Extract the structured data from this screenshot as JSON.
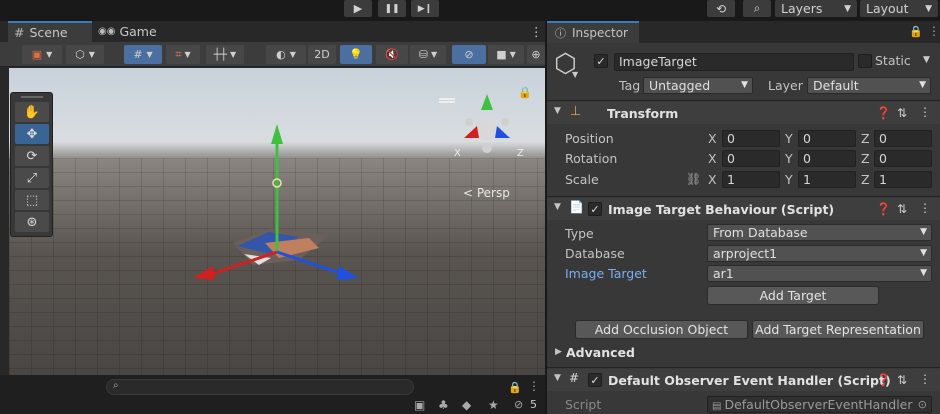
{
  "toolbar": {
    "play_icon": "▶",
    "pause_icon": "❚❚",
    "step_icon": "▶❙",
    "history_icon": "⟲",
    "search_icon": "⌕",
    "layers_label": "Layers",
    "layout_label": "Layout"
  },
  "scene": {
    "tabs": [
      {
        "label": "Scene",
        "icon": "#"
      },
      {
        "label": "Game",
        "icon": "👓"
      }
    ],
    "tool_2d_label": "2D",
    "persp_label": "< Persp",
    "axis_x": "X",
    "axis_z": "Z",
    "bottom_count": "5"
  },
  "inspector": {
    "tab_label": "Inspector",
    "object_name": "ImageTarget",
    "static_label": "Static",
    "tag_label": "Tag",
    "tag_value": "Untagged",
    "layer_label": "Layer",
    "layer_value": "Default",
    "transform": {
      "title": "Transform",
      "rows": [
        {
          "label": "Position",
          "x": "0",
          "y": "0",
          "z": "0"
        },
        {
          "label": "Rotation",
          "x": "0",
          "y": "0",
          "z": "0"
        },
        {
          "label": "Scale",
          "x": "1",
          "y": "1",
          "z": "1"
        }
      ]
    },
    "itb": {
      "title": "Image Target Behaviour (Script)",
      "type_label": "Type",
      "type_value": "From Database",
      "database_label": "Database",
      "database_value": "arproject1",
      "image_target_label": "Image Target",
      "image_target_value": "ar1",
      "add_target_label": "Add Target",
      "add_occlusion_label": "Add Occlusion Object",
      "add_representation_label": "Add Target Representation",
      "advanced_label": "Advanced"
    },
    "doeh": {
      "title": "Default Observer Event Handler (Script)",
      "script_label": "Script",
      "script_value": "DefaultObserverEventHandler"
    }
  },
  "colors": {
    "accent": "#3a79bb",
    "link_label": "#7aaef0",
    "axis_x": "#d02020",
    "axis_y": "#40c040",
    "axis_z": "#2050e0"
  }
}
